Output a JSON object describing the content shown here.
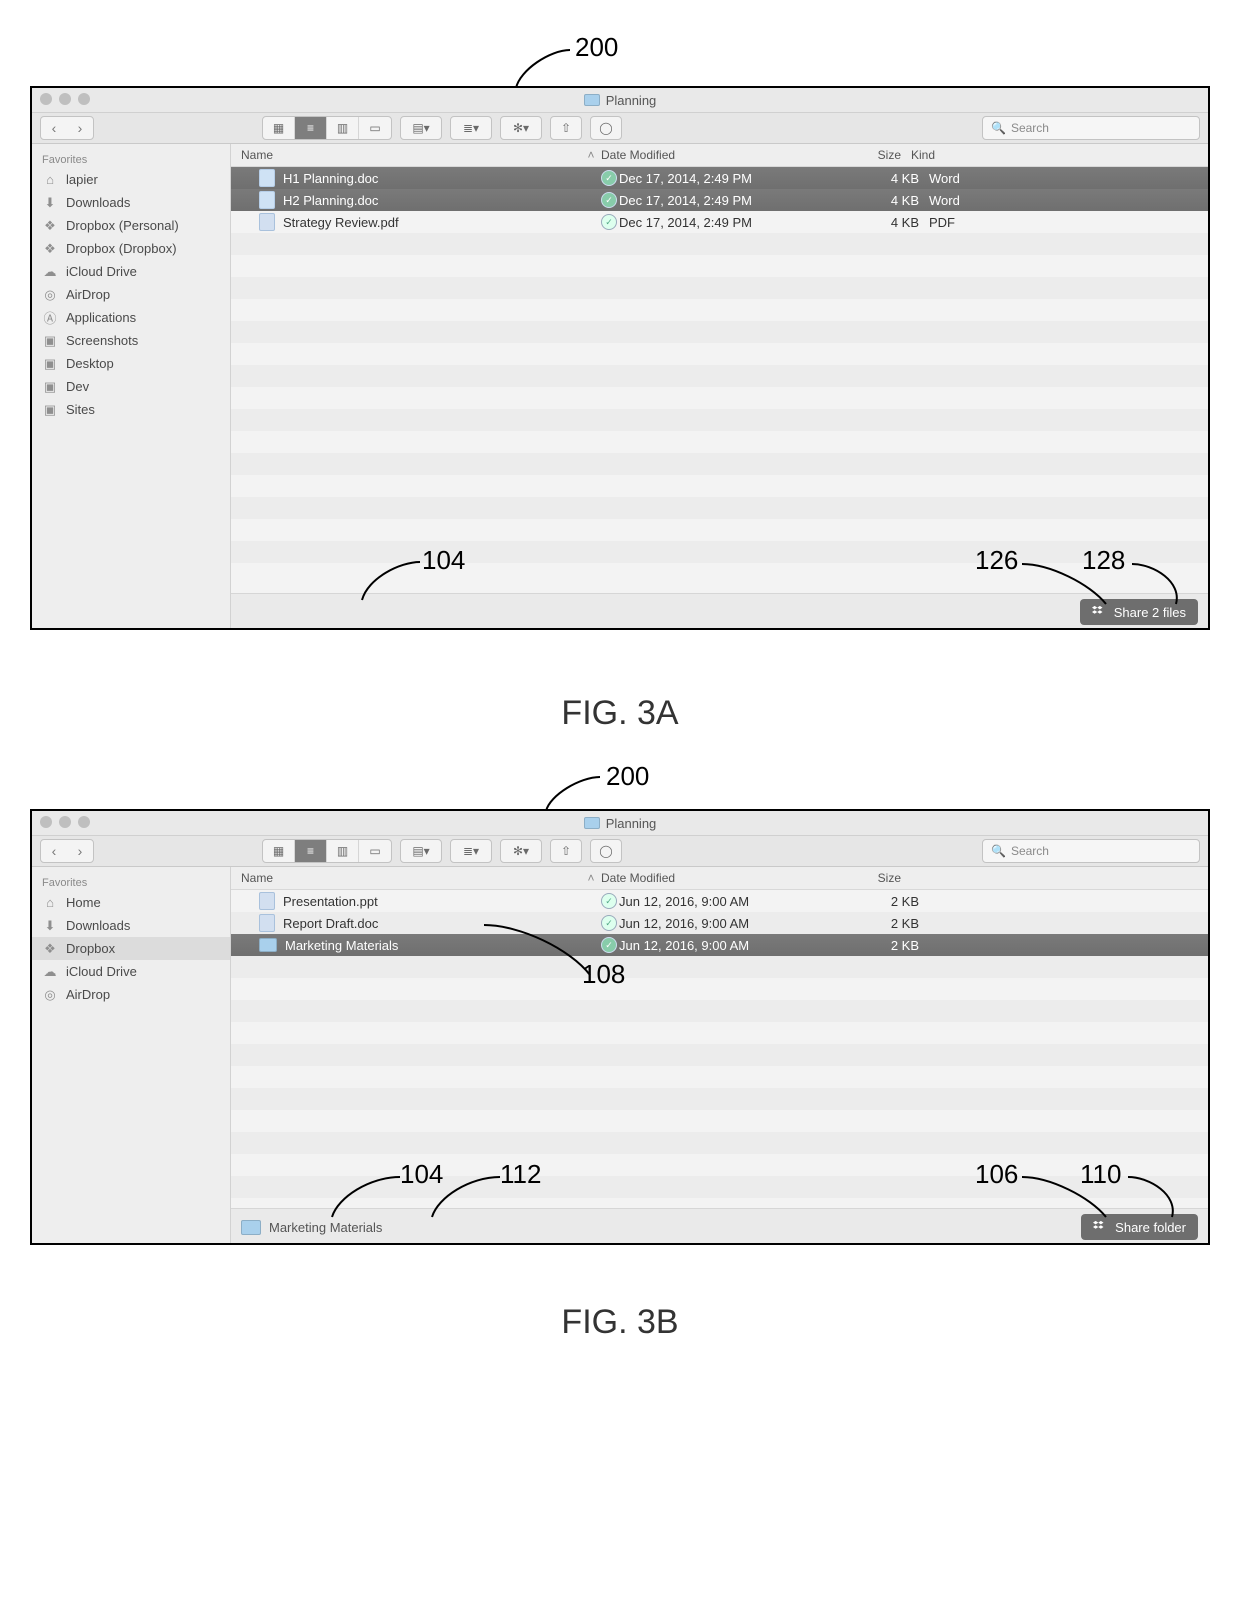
{
  "figA": {
    "ref_top": "200",
    "caption": "FIG. 3A",
    "window_title": "Planning",
    "search_placeholder": "Search",
    "sidebar_header": "Favorites",
    "sidebar": [
      {
        "label": "lapier",
        "icon": "home"
      },
      {
        "label": "Downloads",
        "icon": "downloads"
      },
      {
        "label": "Dropbox (Personal)",
        "icon": "dropbox"
      },
      {
        "label": "Dropbox (Dropbox)",
        "icon": "dropbox"
      },
      {
        "label": "iCloud Drive",
        "icon": "cloud"
      },
      {
        "label": "AirDrop",
        "icon": "airdrop"
      },
      {
        "label": "Applications",
        "icon": "apps"
      },
      {
        "label": "Screenshots",
        "icon": "folder"
      },
      {
        "label": "Desktop",
        "icon": "folder"
      },
      {
        "label": "Dev",
        "icon": "folder"
      },
      {
        "label": "Sites",
        "icon": "folder"
      }
    ],
    "columns": {
      "name": "Name",
      "date": "Date Modified",
      "size": "Size",
      "kind": "Kind"
    },
    "rows": [
      {
        "name": "H1 Planning.doc",
        "date": "Dec 17, 2014, 2:49 PM",
        "size": "4 KB",
        "kind": "Word",
        "selected": true,
        "type": "file"
      },
      {
        "name": "H2 Planning.doc",
        "date": "Dec 17, 2014, 2:49 PM",
        "size": "4 KB",
        "kind": "Word",
        "selected": true,
        "type": "file"
      },
      {
        "name": "Strategy Review.pdf",
        "date": "Dec 17, 2014, 2:49 PM",
        "size": "4 KB",
        "kind": "PDF",
        "selected": false,
        "type": "file"
      }
    ],
    "share_label": "Share 2 files",
    "callouts": {
      "c104": "104",
      "c126": "126",
      "c128": "128"
    }
  },
  "figB": {
    "ref_top": "200",
    "caption": "FIG. 3B",
    "window_title": "Planning",
    "search_placeholder": "Search",
    "sidebar_header": "Favorites",
    "sidebar": [
      {
        "label": "Home",
        "icon": "home"
      },
      {
        "label": "Downloads",
        "icon": "downloads"
      },
      {
        "label": "Dropbox",
        "icon": "dropbox",
        "selected": true
      },
      {
        "label": "iCloud Drive",
        "icon": "cloud"
      },
      {
        "label": "AirDrop",
        "icon": "airdrop"
      }
    ],
    "columns": {
      "name": "Name",
      "date": "Date Modified",
      "size": "Size"
    },
    "rows": [
      {
        "name": "Presentation.ppt",
        "date": "Jun 12, 2016, 9:00 AM",
        "size": "2 KB",
        "selected": false,
        "type": "file"
      },
      {
        "name": "Report Draft.doc",
        "date": "Jun 12, 2016, 9:00 AM",
        "size": "2 KB",
        "selected": false,
        "type": "file"
      },
      {
        "name": "Marketing Materials",
        "date": "Jun 12, 2016, 9:00 AM",
        "size": "2 KB",
        "selected": true,
        "type": "folder"
      }
    ],
    "status_item": "Marketing Materials",
    "share_label": "Share folder",
    "callouts": {
      "c104": "104",
      "c108": "108",
      "c112": "112",
      "c106": "106",
      "c110": "110"
    }
  }
}
